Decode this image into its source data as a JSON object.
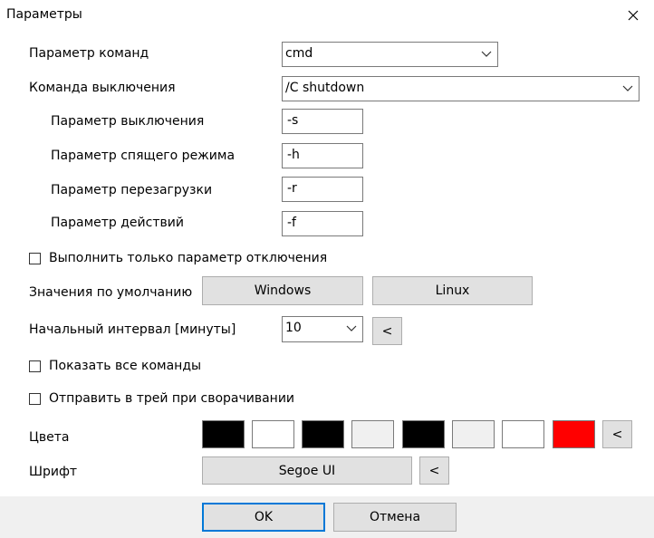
{
  "window": {
    "title": "Параметры"
  },
  "fields": {
    "command_param": {
      "label": "Параметр команд",
      "value": "cmd"
    },
    "shutdown_command": {
      "label": "Команда выключения",
      "value": "/C shutdown"
    },
    "shutdown_param": {
      "label": "Параметр выключения",
      "value": "-s"
    },
    "sleep_param": {
      "label": "Параметр спящего режима",
      "value": "-h"
    },
    "restart_param": {
      "label": "Параметр перезагрузки",
      "value": "-r"
    },
    "action_param": {
      "label": "Параметр действий",
      "value": "-f"
    }
  },
  "options": {
    "only_shutdown_param": {
      "label": "Выполнить только параметр отключения",
      "checked": false
    },
    "show_all_commands": {
      "label": "Показать все команды",
      "checked": false
    },
    "minimize_to_tray": {
      "label": "Отправить в трей при сворачивании",
      "checked": false
    }
  },
  "defaults": {
    "label": "Значения по умолчанию",
    "windows": "Windows",
    "linux": "Linux"
  },
  "interval": {
    "label": "Начальный интервал [минуты]",
    "value": "10",
    "button": "<"
  },
  "colors": {
    "label": "Цвета",
    "swatches": [
      "#000000",
      "#ffffff",
      "#000000",
      "#f0f0f0",
      "#000000",
      "#f0f0f0",
      "#ffffff",
      "#ff0000"
    ],
    "button": "<"
  },
  "font": {
    "label": "Шрифт",
    "value": "Segoe UI",
    "button": "<"
  },
  "footer": {
    "ok": "OK",
    "cancel": "Отмена"
  },
  "accent": "#0078d7"
}
